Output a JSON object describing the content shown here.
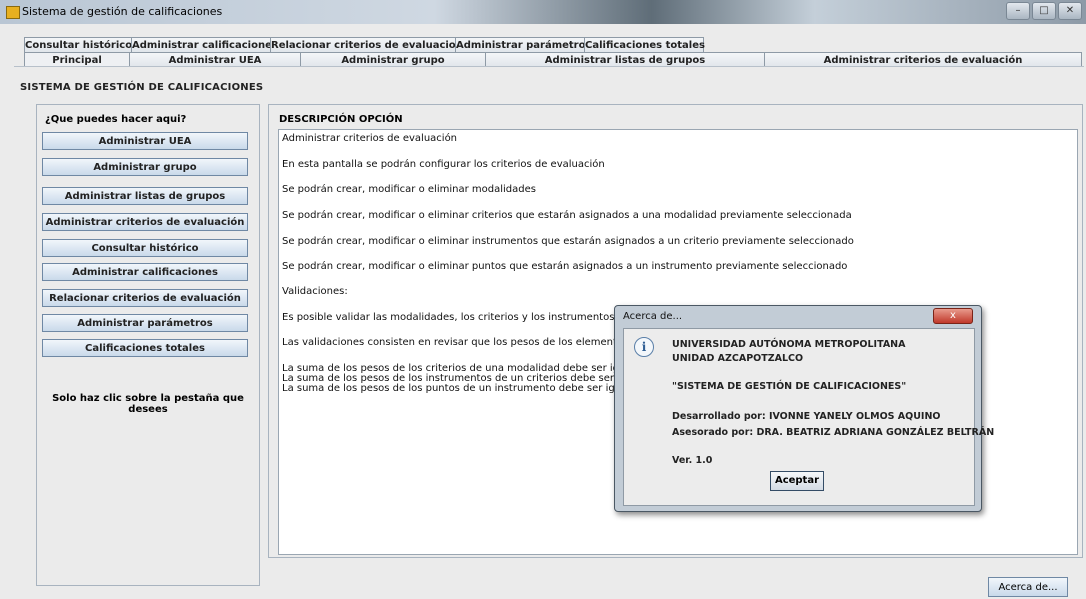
{
  "window": {
    "title": "Sistema de gestión de calificaciones",
    "controls": [
      "–",
      "□",
      "✕"
    ]
  },
  "tabs_top": [
    "Consultar histórico",
    "Administrar calificaciones",
    "Relacionar criterios de evaluacion",
    "Administrar parámetros",
    "Calificaciones totales"
  ],
  "tabs_bottom": [
    "Principal",
    "Administrar UEA",
    "Administrar grupo",
    "Administrar listas de grupos",
    "Administrar criterios de evaluación"
  ],
  "heading": "SISTEMA DE GESTIÓN DE CALIFICACIONES",
  "left": {
    "prompt": "¿Que puedes hacer aqui?",
    "buttons": [
      "Administrar UEA",
      "Administrar grupo",
      "Administrar listas de grupos",
      "Administrar criterios de evaluación",
      "Consultar histórico",
      "Administrar calificaciones",
      "Relacionar criterios de evaluación",
      "Administrar parámetros",
      "Calificaciones totales"
    ],
    "hint": "Solo haz clic sobre la pestaña que desees"
  },
  "right": {
    "title": "DESCRIPCIÓN OPCIÓN",
    "lines": [
      "Administrar criterios de evaluación",
      "En esta pantalla se podrán configurar los criterios de evaluación",
      "Se podrán crear, modificar o eliminar modalidades",
      "Se podrán crear, modificar o eliminar criterios que estarán asignados a una modalidad previamente seleccionada",
      "Se podrán crear, modificar o eliminar instrumentos que estarán asignados a un criterio previamente seleccionado",
      "Se podrán crear, modificar o eliminar puntos que estarán asignados a un instrumento previamente seleccionado",
      "Validaciones:",
      "Es posible validar las modalidades, los criterios y los instrumentos",
      "Las validaciones consisten en revisar que los pesos de los elementos",
      "La suma de los pesos de los criterios de una modalidad debe ser igual",
      "La suma de los pesos de los instrumentos de un criterios debe ser igual",
      "La suma de los pesos de los puntos de un instrumento debe ser igual a"
    ]
  },
  "about_button": "Acerca de...",
  "dialog": {
    "title": "Acerca de...",
    "close": "x",
    "lines": [
      "UNIVERSIDAD AUTÓNOMA METROPOLITANA",
      "UNIDAD AZCAPOTZALCO",
      "\"SISTEMA DE GESTIÓN DE CALIFICACIONES\"",
      "Desarrollado por: IVONNE YANELY OLMOS AQUINO",
      "Asesorado por: DRA. BEATRIZ ADRIANA GONZÁLEZ BELTRÁN",
      "Ver. 1.0"
    ],
    "ok": "Aceptar"
  }
}
